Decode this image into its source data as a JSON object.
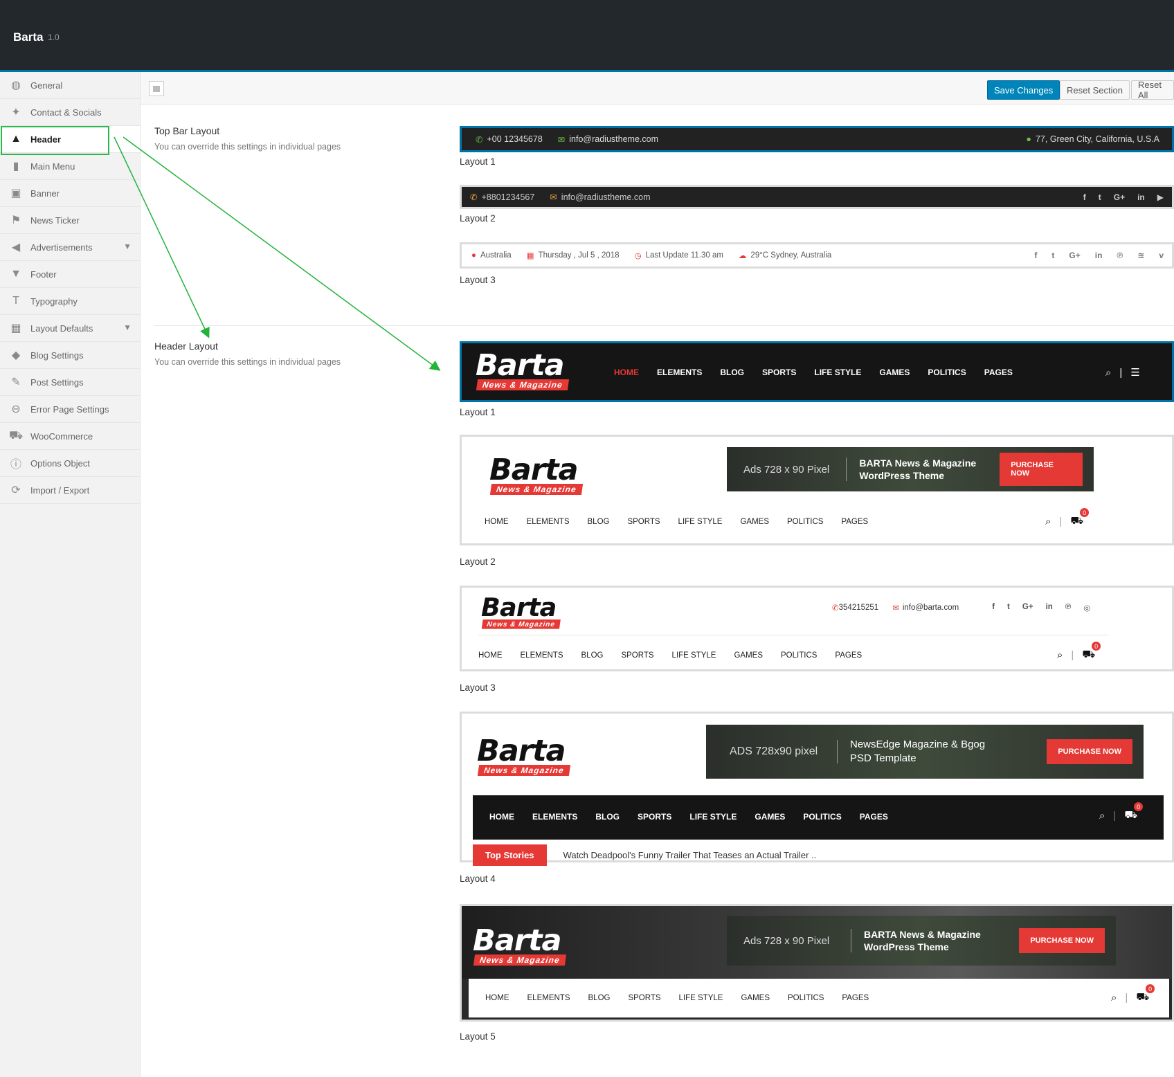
{
  "app": {
    "title": "Barta",
    "version": "1.0"
  },
  "sidebar": {
    "items": [
      {
        "label": "General"
      },
      {
        "label": "Contact & Socials"
      },
      {
        "label": "Header"
      },
      {
        "label": "Main Menu"
      },
      {
        "label": "Banner"
      },
      {
        "label": "News Ticker"
      },
      {
        "label": "Advertisements"
      },
      {
        "label": "Footer"
      },
      {
        "label": "Typography"
      },
      {
        "label": "Layout Defaults"
      },
      {
        "label": "Blog Settings"
      },
      {
        "label": "Post Settings"
      },
      {
        "label": "Error Page Settings"
      },
      {
        "label": "WooCommerce"
      },
      {
        "label": "Options Object"
      },
      {
        "label": "Import / Export"
      }
    ]
  },
  "toolbar": {
    "save": "Save Changes",
    "reset_section": "Reset Section",
    "reset_all": "Reset All"
  },
  "topbar_section": {
    "title": "Top Bar Layout",
    "desc": "You can override this settings in individual pages",
    "layout1": {
      "phone": "+00 12345678",
      "email": "info@radiustheme.com",
      "address": "77, Green City, California, U.S.A",
      "label": "Layout 1"
    },
    "layout2": {
      "phone": "+8801234567",
      "email": "info@radiustheme.com",
      "label": "Layout 2"
    },
    "layout3": {
      "location": "Australia",
      "date": "Thursday , Jul 5 , 2018",
      "update": "Last Update 11.30 am",
      "weather": "29°C Sydney, Australia",
      "label": "Layout 3"
    }
  },
  "header_section": {
    "title": "Header Layout",
    "desc": "You can override this settings in individual pages",
    "logo_word": "Barta",
    "logo_tag": "News & Magazine",
    "nav": [
      "HOME",
      "ELEMENTS",
      "BLOG",
      "SPORTS",
      "LIFE STYLE",
      "GAMES",
      "POLITICS",
      "PAGES"
    ],
    "labels": [
      "Layout 1",
      "Layout 2",
      "Layout 3",
      "Layout 4",
      "Layout 5"
    ],
    "ad_a": {
      "size": "Ads 728 x 90 Pixel",
      "title": "BARTA News & Magazine WordPress Theme",
      "button": "PURCHASE NOW"
    },
    "ad_b": {
      "size": "ADS 728x90 pixel",
      "title": "NewsEdge Magazine & Bgog PSD Template",
      "button": "PURCHASE NOW"
    },
    "layout3_contact": {
      "phone": "354215251",
      "email": "info@barta.com"
    },
    "cart_count": "0",
    "ticker": {
      "label": "Top Stories",
      "headline": "Watch Deadpool's Funny Trailer That Teases an Actual Trailer .."
    }
  }
}
